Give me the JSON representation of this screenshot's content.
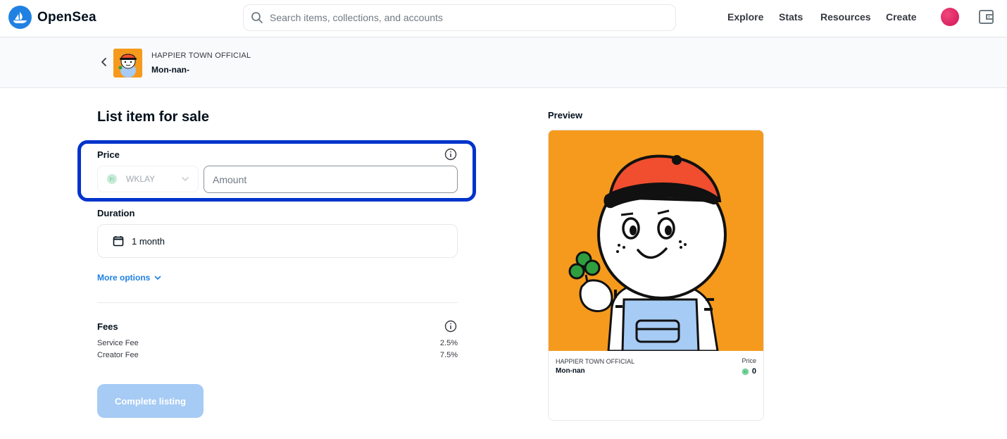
{
  "nav": {
    "brand": "OpenSea",
    "search_placeholder": "Search items, collections, and accounts",
    "links": [
      "Explore",
      "Stats",
      "Resources",
      "Create"
    ]
  },
  "breadcrumb": {
    "collection": "HAPPIER TOWN OFFICIAL",
    "item": "Mon-nan-"
  },
  "form": {
    "title": "List item for sale",
    "price_label": "Price",
    "currency": "WKLAY",
    "amount_placeholder": "Amount",
    "duration_label": "Duration",
    "duration_value": "1 month",
    "more_options": "More options",
    "fees_label": "Fees",
    "fees": [
      {
        "name": "Service Fee",
        "value": "2.5%"
      },
      {
        "name": "Creator Fee",
        "value": "7.5%"
      }
    ],
    "submit": "Complete listing"
  },
  "preview": {
    "label": "Preview",
    "collection": "HAPPIER TOWN OFFICIAL",
    "name": "Mon-nan",
    "price_label": "Price",
    "price": "0"
  },
  "colors": {
    "accent": "#2081e2",
    "highlight": "#0033cc",
    "artwork_bg": "#f59a1d"
  }
}
